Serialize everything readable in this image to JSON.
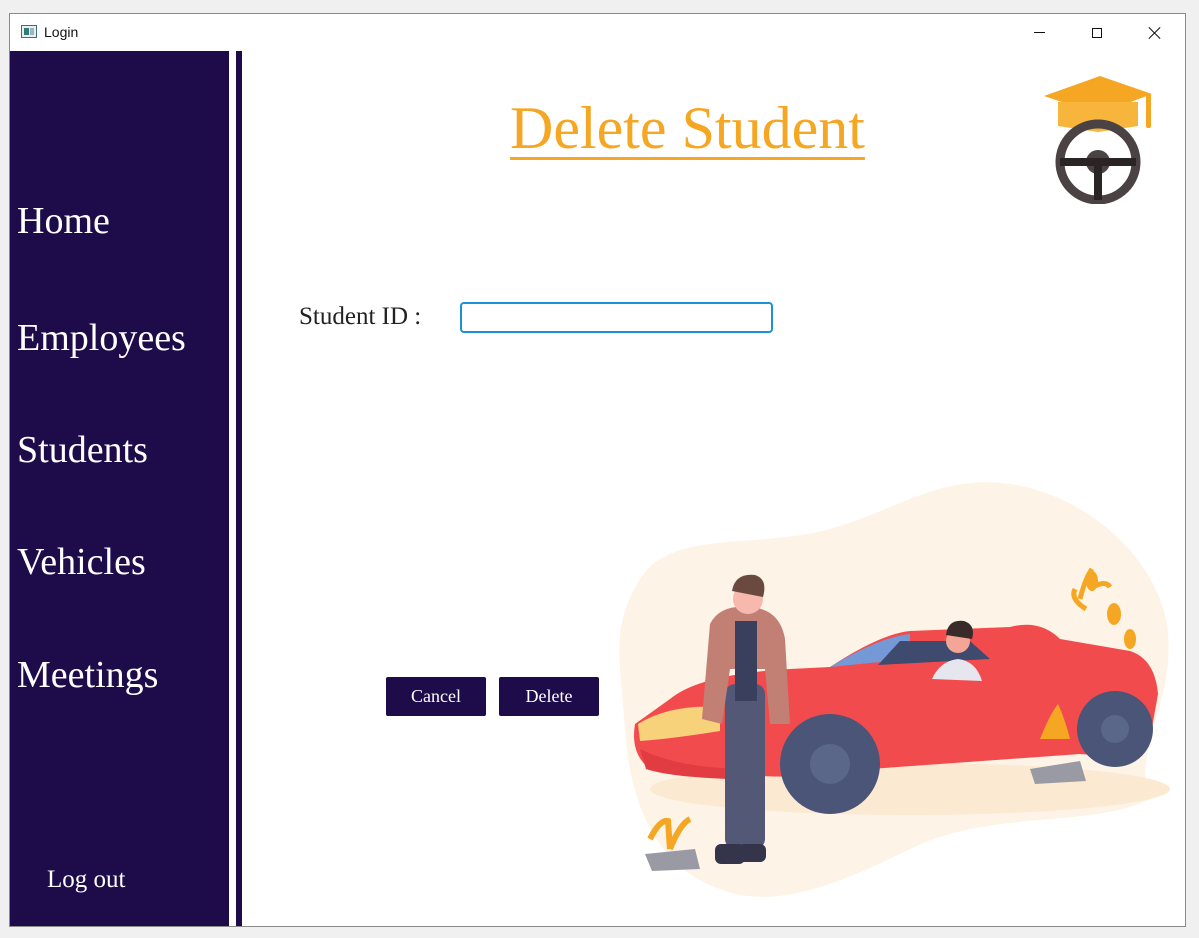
{
  "window": {
    "title": "Login"
  },
  "sidebar": {
    "items": [
      {
        "label": "Home"
      },
      {
        "label": "Employees"
      },
      {
        "label": "Students"
      },
      {
        "label": "Vehicles"
      },
      {
        "label": "Meetings"
      }
    ],
    "logout_label": "Log out"
  },
  "main": {
    "title": "Delete Student",
    "student_id_label": "Student ID :",
    "student_id_value": "",
    "cancel_label": "Cancel",
    "delete_label": "Delete"
  },
  "colors": {
    "sidebar_bg": "#1e0b4a",
    "accent": "#f5a623",
    "button_bg": "#1e0b4a",
    "input_focus": "#1e90d8"
  },
  "icons": [
    "app-icon",
    "minimize-icon",
    "maximize-icon",
    "close-icon",
    "graduation-cap-steering-wheel-logo",
    "person-car-illustration"
  ]
}
